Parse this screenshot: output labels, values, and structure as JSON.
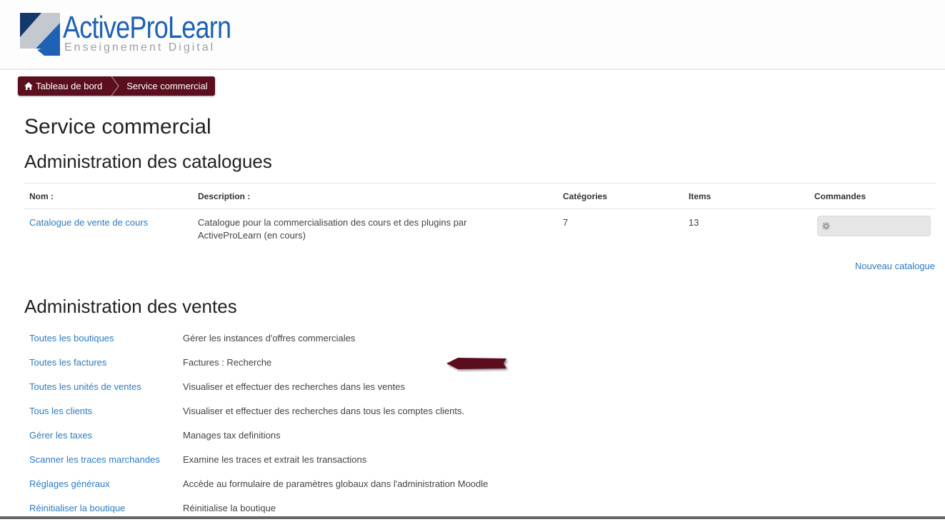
{
  "brand": {
    "title": "ActiveProLearn",
    "subtitle": "Enseignement Digital",
    "colors": {
      "primary": "#1e62b4",
      "dark": "#14386c",
      "grey": "#c4c9cf"
    }
  },
  "breadcrumb": {
    "items": [
      {
        "label": "Tableau de bord",
        "icon": "home-icon"
      },
      {
        "label": "Service commercial"
      }
    ],
    "color": "#5a0e1e"
  },
  "page": {
    "title": "Service commercial"
  },
  "catalogues": {
    "title": "Administration des catalogues",
    "headers": {
      "nom": "Nom :",
      "description": "Description :",
      "categories": "Catégories",
      "items": "Items",
      "commandes": "Commandes"
    },
    "rows": [
      {
        "nom": "Catalogue de vente de cours",
        "description": "Catalogue  pour la commercialisation des cours et des plugins par ActiveProLearn (en cours)",
        "categories": "7",
        "items": "13",
        "command_icon": "gear-icon"
      }
    ],
    "new_link": "Nouveau catalogue"
  },
  "ventes": {
    "title": "Administration des ventes",
    "items": [
      {
        "label": "Toutes les boutiques",
        "description": "Gérer les instances d'offres commerciales"
      },
      {
        "label": "Toutes les factures",
        "description": "Factures : Recherche"
      },
      {
        "label": "Toutes les unités de ventes",
        "description": "Visualiser et effectuer des recherches dans les ventes"
      },
      {
        "label": "Tous les clients",
        "description": "Visualiser et effectuer des recherches dans tous les comptes clients."
      },
      {
        "label": "Gérer les taxes",
        "description": "Manages tax definitions"
      },
      {
        "label": "Scanner les traces marchandes",
        "description": "Examine les traces et extrait les transactions"
      },
      {
        "label": "Réglages généraux",
        "description": "Accède au formulaire de paramètres globaux dans l'administration Moodle"
      },
      {
        "label": "Réinitialiser la boutique",
        "description": "Réinitialise la boutique"
      }
    ]
  },
  "annotation": {
    "icon": "arrow-pointer-icon",
    "color": "#5a0e1e"
  },
  "link_color": "#2e7bbf"
}
